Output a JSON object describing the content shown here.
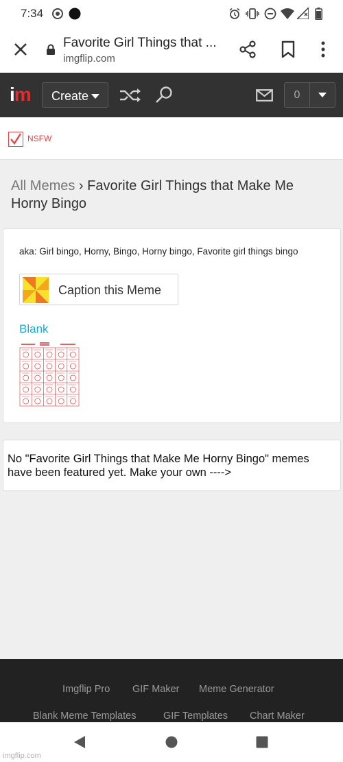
{
  "status_bar": {
    "time": "7:34"
  },
  "browser": {
    "page_title": "Favorite Girl Things that ...",
    "domain": "imgflip.com"
  },
  "header": {
    "create_label": "Create",
    "notification_count": "0"
  },
  "nsfw": {
    "label": "NSFW",
    "checked": true
  },
  "breadcrumb": {
    "root": "All Memes",
    "separator": "›",
    "current": "Favorite Girl Things that Make Me Horny Bingo"
  },
  "meme": {
    "aka": "aka: Girl bingo, Horny, Bingo, Horny bingo, Favorite girl things bingo",
    "caption_button": "Caption this Meme",
    "blank_link": "Blank"
  },
  "featured_notice": "No \"Favorite Girl Things that Make Me Horny Bingo\" memes have been featured yet. Make your own ---->",
  "footer": {
    "links": [
      "Imgflip Pro",
      "GIF Maker",
      "Meme Generator",
      "Blank Meme Templates",
      "GIF Templates",
      "Chart Maker"
    ]
  },
  "watermark": "imgflip.com",
  "colors": {
    "header_bg": "#323232",
    "logo_red": "#e52b2b",
    "nsfw_red": "#e04444",
    "link_blue": "#21a9d6",
    "footer_bg": "#222222"
  }
}
